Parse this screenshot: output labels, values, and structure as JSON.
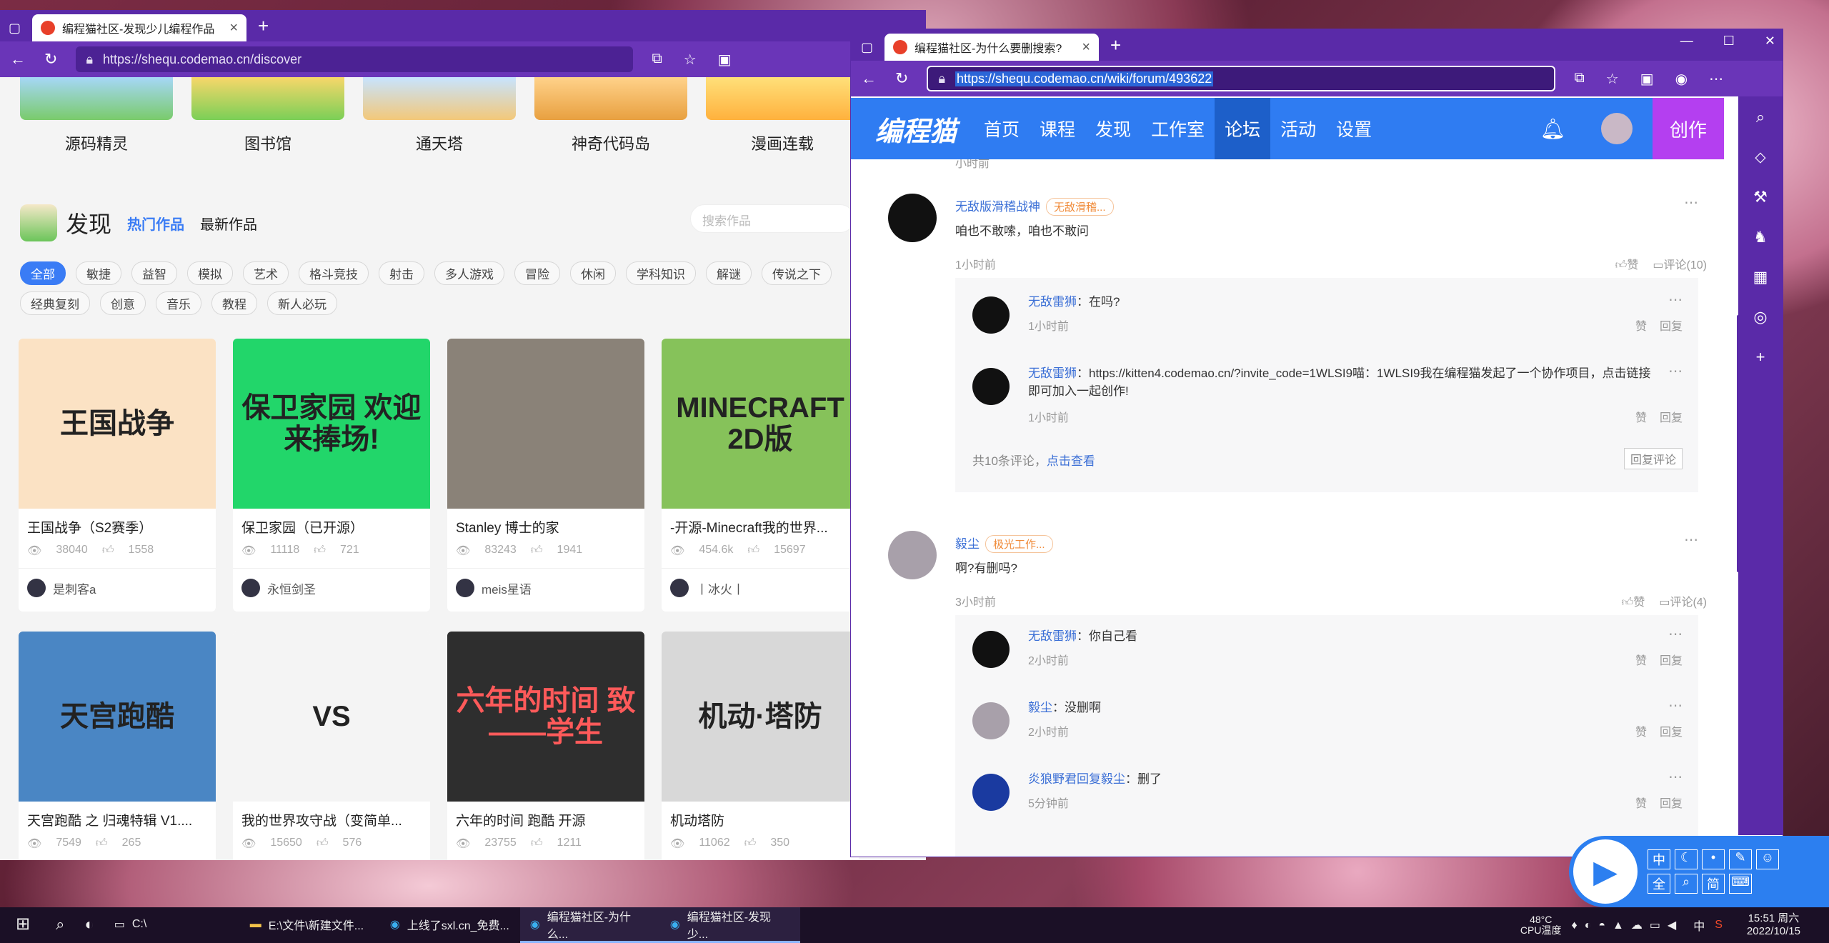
{
  "left_window": {
    "tab_title": "编程猫社区-发现少儿编程作品",
    "url": "https://shequ.codemao.cn/discover",
    "categories": [
      "源码精灵",
      "图书馆",
      "通天塔",
      "神奇代码岛",
      "漫画连载"
    ],
    "discover_title": "发现",
    "hot_tab": "热门作品",
    "new_tab": "最新作品",
    "search_placeholder": "搜索作品",
    "tags_row1": [
      "全部",
      "敏捷",
      "益智",
      "模拟",
      "艺术",
      "格斗竞技",
      "射击",
      "多人游戏",
      "冒险",
      "休闲",
      "学科知识",
      "解谜",
      "传说之下"
    ],
    "tags_row2": [
      "经典复刻",
      "创意",
      "音乐",
      "教程",
      "新人必玩"
    ],
    "works": [
      {
        "title": "王国战争（S2赛季）",
        "views": "38040",
        "likes": "1558",
        "author": "是刺客a",
        "thumb_text": "王国战争",
        "thumb_bg": "#fbe2c4"
      },
      {
        "title": "保卫家园（已开源）",
        "views": "11118",
        "likes": "721",
        "author": "永恒剑圣",
        "thumb_text": "保卫家园 欢迎来捧场!",
        "thumb_bg": "#22d66a"
      },
      {
        "title": "Stanley 博士的家",
        "views": "83243",
        "likes": "1941",
        "author": "meis星语",
        "thumb_text": "",
        "thumb_bg": "#8a8278"
      },
      {
        "title": "-开源-Minecraft我的世界...",
        "views": "454.6k",
        "likes": "15697",
        "author": "丨冰火丨",
        "thumb_text": "MINECRAFT 2D版",
        "thumb_bg": "#86c25a"
      },
      {
        "title": "天宫跑酷 之 归魂特辑 V1....",
        "views": "7549",
        "likes": "265",
        "author": "",
        "thumb_text": "天宫跑酷",
        "thumb_bg": "#4a86c4"
      },
      {
        "title": "我的世界攻守战（变简单...",
        "views": "15650",
        "likes": "576",
        "author": "",
        "thumb_text": "VS",
        "thumb_bg": "#f4f4f4"
      },
      {
        "title": "六年的时间 跑酷 开源",
        "views": "23755",
        "likes": "1211",
        "author": "",
        "thumb_text": "六年的时间 致——学生",
        "thumb_bg": "#2e2e2e"
      },
      {
        "title": "机动塔防",
        "views": "11062",
        "likes": "350",
        "author": "",
        "thumb_text": "机动·塔防",
        "thumb_bg": "#d8d8d8"
      }
    ]
  },
  "right_window": {
    "tab_title": "编程猫社区-为什么要删搜索?",
    "url": "https://shequ.codemao.cn/wiki/forum/493622",
    "logo": "编程猫",
    "nav": [
      "首页",
      "课程",
      "发现",
      "工作室",
      "论坛",
      "活动",
      "设置"
    ],
    "create": "创作",
    "top_partial": "小时前",
    "posts": [
      {
        "user": "无敌版滑稽战神",
        "badge": "无敌滑稽...",
        "text": "咱也不敢嗦，咱也不敢问",
        "time": "1小时前",
        "like": "赞",
        "comments": "评论(10)",
        "replies": [
          {
            "user": "无敌雷狮",
            "text": "在吗?",
            "time": "1小时前"
          },
          {
            "user": "无敌雷狮",
            "text": "https://kitten4.codemao.cn/?invite_code=1WLSI9喵：1WLSI9我在编程猫发起了一个协作项目，点击链接即可加入一起创作!",
            "time": "1小时前"
          }
        ],
        "summary": "共10条评论，",
        "view_all": "点击查看",
        "reply_btn": "回复评论"
      },
      {
        "user": "毅尘",
        "badge": "极光工作...",
        "text": "啊?有删吗?",
        "time": "3小时前",
        "like": "赞",
        "comments": "评论(4)",
        "replies": [
          {
            "user": "无敌雷狮",
            "text": "你自己看",
            "time": "2小时前"
          },
          {
            "user": "毅尘",
            "text": "没删啊",
            "time": "2小时前"
          },
          {
            "user": "炎狼野君回复毅尘",
            "text": "删了",
            "time": "5分钟前"
          }
        ]
      }
    ],
    "reply_like": "赞",
    "reply_reply": "回复"
  },
  "taskbar": {
    "items": [
      "C:\\",
      "E:\\文件\\新建文件...",
      "上线了sxl.cn_免费...",
      "编程猫社区-为什么...",
      "编程猫社区-发现少..."
    ],
    "temp": "48°C",
    "temp_label": "CPU温度",
    "lang": "中",
    "time": "15:51 周六",
    "date": "2022/10/15"
  },
  "ime": {
    "buttons": [
      "中",
      "简"
    ]
  }
}
